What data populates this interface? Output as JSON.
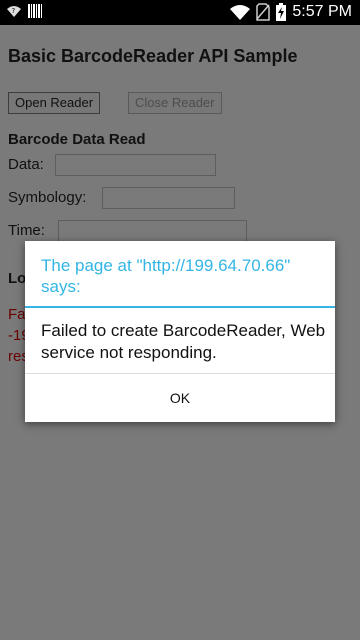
{
  "status_bar": {
    "time": "5:57 PM",
    "left_icons": [
      "wifi-question-icon",
      "barcode-icon"
    ],
    "right_icons": [
      "wifi-icon",
      "no-sim-icon",
      "battery-charging-icon"
    ]
  },
  "page": {
    "title": "Basic BarcodeReader API Sample",
    "buttons": {
      "open": "Open Reader",
      "close": "Close Reader"
    },
    "barcode_section": {
      "heading": "Barcode Data Read",
      "data_label": "Data:",
      "symbology_label": "Symbology:",
      "time_label": "Time:"
    },
    "log_section": {
      "heading_partial": "Lo",
      "lines": [
        "Fa",
        "-19",
        "res"
      ]
    }
  },
  "dialog": {
    "title": "The page at \"http://199.64.70.66\" says:",
    "message": "Failed to create BarcodeReader, Web service not responding.",
    "ok_label": "OK",
    "accent_color": "#33b5e5"
  }
}
